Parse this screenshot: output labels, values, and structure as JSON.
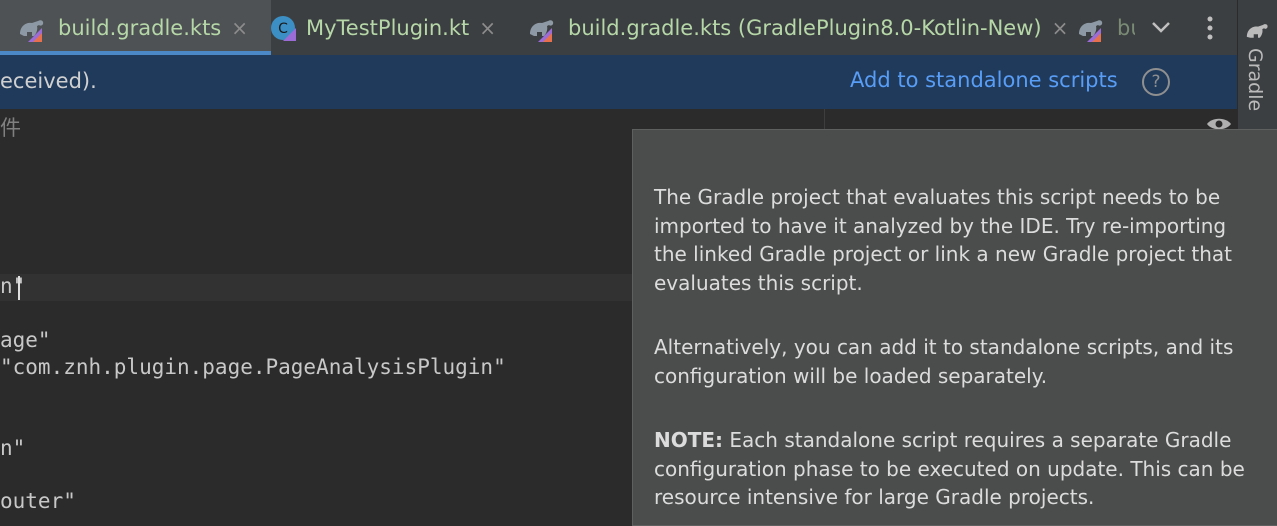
{
  "tabs": [
    {
      "label": "build.gradle.kts",
      "icon": "gradle-kotlin-icon",
      "active": true
    },
    {
      "label": "MyTestPlugin.kt",
      "icon": "kotlin-class-icon",
      "active": false
    },
    {
      "label": "build.gradle.kts (GradlePlugin8.0-Kotlin-New)",
      "icon": "gradle-kotlin-icon",
      "active": false
    },
    {
      "label": "bu",
      "icon": "gradle-kotlin-icon",
      "active": false
    }
  ],
  "tab_close_glyph": "×",
  "toolstrip": {
    "label": "Gradle"
  },
  "banner": {
    "message": "eceived).",
    "action": "Add to standalone scripts",
    "help": "?"
  },
  "editor": {
    "lines": [
      {
        "text": "件",
        "kind": "comment"
      },
      {
        "text": "n\"",
        "kind": "string"
      },
      {
        "text": "age\"",
        "kind": "string"
      },
      {
        "text": "\"com.znh.plugin.page.PageAnalysisPlugin\"",
        "kind": "string"
      },
      {
        "text": "n\"",
        "kind": "string"
      },
      {
        "text": "outer\"",
        "kind": "string"
      },
      {
        "text": "                         ",
        "kind": "string"
      }
    ]
  },
  "popup": {
    "para1": "The Gradle project that evaluates this script needs to be imported to have it analyzed by the IDE. Try re-importing the linked Gradle project or link a new Gradle project that evaluates this script.",
    "para2": "Alternatively, you can add it to standalone scripts, and its configuration will be loaded separately.",
    "note_label": "NOTE:",
    "note_text": " Each standalone script requires a separate Gradle configuration phase to be executed on update. This can be resource intensive for large Gradle projects."
  },
  "colors": {
    "accent": "#4a88c7",
    "link": "#589df6",
    "banner_bg": "#203a5c",
    "popup_bg": "#4b4d4d",
    "tab_text": "#b6d7a8"
  }
}
